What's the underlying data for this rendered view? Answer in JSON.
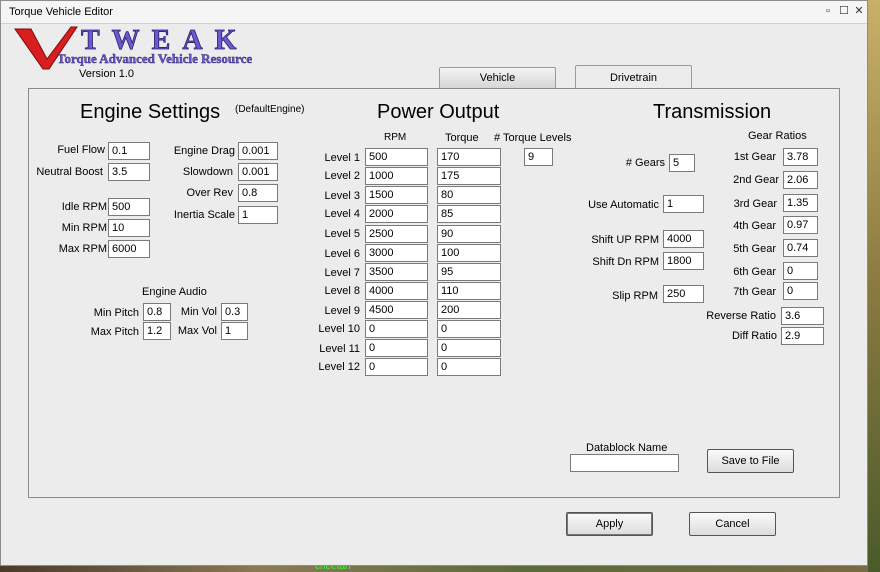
{
  "window": {
    "title": "Torque Vehicle Editor",
    "minimize": "▫",
    "maximize": "☐",
    "close": "✕"
  },
  "logo": {
    "word": "TWEAK",
    "letter": "V",
    "tagline": "Torque Advanced Vehicle Resource"
  },
  "version": "Version 1.0",
  "tabs": [
    {
      "label": "Vehicle",
      "active": false
    },
    {
      "label": "Drivetrain",
      "active": true
    }
  ],
  "engine": {
    "heading": "Engine Settings",
    "name": "(DefaultEngine)",
    "fuel_flow_label": "Fuel Flow",
    "fuel_flow": "0.1",
    "neutral_boost_label": "Neutral Boost",
    "neutral_boost": "3.5",
    "idle_rpm_label": "Idle RPM",
    "idle_rpm": "500",
    "min_rpm_label": "Min RPM",
    "min_rpm": "10",
    "max_rpm_label": "Max RPM",
    "max_rpm": "6000",
    "engine_drag_label": "Engine Drag",
    "engine_drag": "0.001",
    "slowdown_label": "Slowdown",
    "slowdown": "0.001",
    "over_rev_label": "Over Rev",
    "over_rev": "0.8",
    "inertia_scale_label": "Inertia Scale",
    "inertia_scale": "1"
  },
  "audio": {
    "heading": "Engine Audio",
    "min_pitch_label": "Min Pitch",
    "min_pitch": "0.8",
    "max_pitch_label": "Max Pitch",
    "max_pitch": "1.2",
    "min_vol_label": "Min Vol",
    "min_vol": "0.3",
    "max_vol_label": "Max Vol",
    "max_vol": "1"
  },
  "power": {
    "heading": "Power Output",
    "rpm_header": "RPM",
    "torque_header": "Torque",
    "levels_header": "# Torque Levels",
    "levels": "9",
    "rows": [
      {
        "label": "Level 1",
        "rpm": "500",
        "torque": "170"
      },
      {
        "label": "Level 2",
        "rpm": "1000",
        "torque": "175"
      },
      {
        "label": "Level 3",
        "rpm": "1500",
        "torque": "80"
      },
      {
        "label": "Level 4",
        "rpm": "2000",
        "torque": "85"
      },
      {
        "label": "Level 5",
        "rpm": "2500",
        "torque": "90"
      },
      {
        "label": "Level 6",
        "rpm": "3000",
        "torque": "100"
      },
      {
        "label": "Level 7",
        "rpm": "3500",
        "torque": "95"
      },
      {
        "label": "Level 8",
        "rpm": "4000",
        "torque": "110"
      },
      {
        "label": "Level 9",
        "rpm": "4500",
        "torque": "200"
      },
      {
        "label": "Level 10",
        "rpm": "0",
        "torque": "0"
      },
      {
        "label": "Level 11",
        "rpm": "0",
        "torque": "0"
      },
      {
        "label": "Level 12",
        "rpm": "0",
        "torque": "0"
      }
    ]
  },
  "transmission": {
    "heading": "Transmission",
    "gears_label": "# Gears",
    "gears": "5",
    "use_auto_label": "Use Automatic",
    "use_auto": "1",
    "shift_up_label": "Shift UP RPM",
    "shift_up": "4000",
    "shift_dn_label": "Shift Dn RPM",
    "shift_dn": "1800",
    "slip_label": "Slip RPM",
    "slip": "250",
    "ratios_heading": "Gear Ratios",
    "ratios": [
      {
        "label": "1st Gear",
        "value": "3.78"
      },
      {
        "label": "2nd Gear",
        "value": "2.06"
      },
      {
        "label": "3rd Gear",
        "value": "1.35"
      },
      {
        "label": "4th Gear",
        "value": "0.97"
      },
      {
        "label": "5th Gear",
        "value": "0.74"
      },
      {
        "label": "6th Gear",
        "value": "0"
      },
      {
        "label": "7th Gear",
        "value": "0"
      }
    ],
    "reverse_label": "Reverse Ratio",
    "reverse": "3.6",
    "diff_label": "Diff Ratio",
    "diff": "2.9"
  },
  "datablock": {
    "label": "Datablock Name",
    "value": ""
  },
  "buttons": {
    "save": "Save to File",
    "apply": "Apply",
    "cancel": "Cancel"
  },
  "background_text": "cheetah",
  "colors": {
    "logo_red": "#d81e1e",
    "logo_purple": "#6a5ad0",
    "window_bg": "#ececec"
  }
}
